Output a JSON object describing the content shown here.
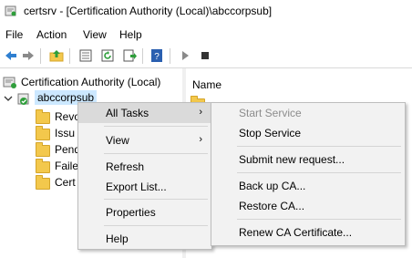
{
  "window": {
    "title": "certsrv - [Certification Authority (Local)\\abccorpsub]"
  },
  "menubar": [
    "File",
    "Action",
    "View",
    "Help"
  ],
  "tree": {
    "root": "Certification Authority (Local)",
    "ca": "abccorpsub",
    "folders": [
      "Revo",
      "Issu",
      "Pend",
      "Faile",
      "Cert"
    ]
  },
  "list": {
    "header": "Name"
  },
  "context_menu": {
    "all_tasks": "All Tasks",
    "view": "View",
    "refresh": "Refresh",
    "export_list": "Export List...",
    "properties": "Properties",
    "help": "Help"
  },
  "submenu": {
    "start_service": "Start Service",
    "stop_service": "Stop Service",
    "submit_request": "Submit new request...",
    "backup": "Back up CA...",
    "restore": "Restore CA...",
    "renew": "Renew CA Certificate..."
  },
  "colors": {
    "highlight": "#dadada",
    "selection": "#cce8ff",
    "folder": "#f3c84c"
  }
}
